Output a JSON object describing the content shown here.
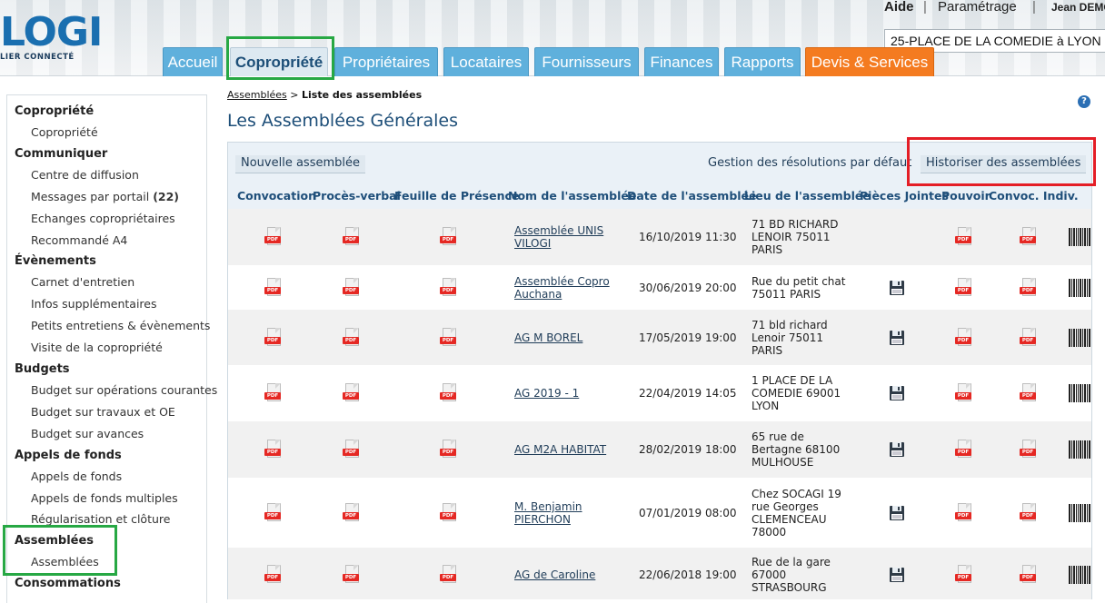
{
  "header": {
    "logo_text": "LOGI",
    "logo_sub": "LIER CONNECTÉ",
    "aide": "Aide",
    "sep": "|",
    "parametrage": "Paramétrage",
    "user": "Jean DEMO",
    "property": "25-PLACE DE LA COMEDIE à LYON"
  },
  "tabs": [
    {
      "label": "Accueil"
    },
    {
      "label": "Copropriété"
    },
    {
      "label": "Propriétaires"
    },
    {
      "label": "Locataires"
    },
    {
      "label": "Fournisseurs"
    },
    {
      "label": "Finances"
    },
    {
      "label": "Rapports"
    },
    {
      "label": "Devis & Services"
    }
  ],
  "sidebar": [
    {
      "label": "Copropriété"
    },
    {
      "label": "Copropriété"
    },
    {
      "label": "Communiquer"
    },
    {
      "label": "Centre de diffusion"
    },
    {
      "label": "Messages par portail",
      "count": "(22)"
    },
    {
      "label": "Echanges copropriétaires"
    },
    {
      "label": "Recommandé A4"
    },
    {
      "label": "Évènements"
    },
    {
      "label": "Carnet d'entretien"
    },
    {
      "label": "Infos supplémentaires"
    },
    {
      "label": "Petits entretiens & évènements"
    },
    {
      "label": "Visite de la copropriété"
    },
    {
      "label": "Budgets"
    },
    {
      "label": "Budget sur opérations courantes"
    },
    {
      "label": "Budget sur travaux et OE"
    },
    {
      "label": "Budget sur avances"
    },
    {
      "label": "Appels de fonds"
    },
    {
      "label": "Appels de fonds"
    },
    {
      "label": "Appels de fonds multiples"
    },
    {
      "label": "Régularisation et clôture"
    },
    {
      "label": "Assemblées"
    },
    {
      "label": "Assemblées"
    },
    {
      "label": "Consommations"
    }
  ],
  "breadcrumb": {
    "link": "Assemblées",
    "sep": " > ",
    "current": "Liste des assemblées"
  },
  "help": "?",
  "page_title": "Les Assemblées Générales",
  "buttons": {
    "new": "Nouvelle assemblée",
    "resolutions": "Gestion des résolutions par défaut",
    "history": "Historiser des assemblées"
  },
  "columns": [
    "Convocation",
    "Procès-verbal",
    "Feuille de Présence",
    "Nom de l'assemblée",
    "Date de l'assemblée",
    "Lieu de l'assemblée",
    "Pièces Jointes",
    "Pouvoir",
    "Convoc. Indiv."
  ],
  "pdf_label": "PDF",
  "rows": [
    {
      "name": [
        "Assemblée UNIS",
        "VILOGI"
      ],
      "date": "16/10/2019 11:30",
      "lieu": [
        "71 BD RICHARD",
        "LENOIR 75011",
        "PARIS"
      ],
      "attach": false
    },
    {
      "name": [
        "Assemblée Copro",
        "Auchana"
      ],
      "date": "30/06/2019 20:00",
      "lieu": [
        "Rue du petit chat",
        "75011 PARIS"
      ],
      "attach": true
    },
    {
      "name": [
        "AG M BOREL"
      ],
      "date": "17/05/2019 19:00",
      "lieu": [
        "71 bld richard",
        "Lenoir 75011",
        "PARIS"
      ],
      "attach": true
    },
    {
      "name": [
        "AG 2019 - 1"
      ],
      "date": "22/04/2019 14:05",
      "lieu": [
        "1 PLACE DE LA",
        "COMEDIE 69001",
        "LYON"
      ],
      "attach": true
    },
    {
      "name": [
        "AG M2A HABITAT"
      ],
      "date": "28/02/2019 18:00",
      "lieu": [
        "65 rue de",
        "Bertagne 68100",
        "MULHOUSE"
      ],
      "attach": true
    },
    {
      "name": [
        "M. Benjamin",
        "PIERCHON"
      ],
      "date": "07/01/2019 08:00",
      "lieu": [
        "Chez SOCAGI 19",
        "rue Georges",
        "CLEMENCEAU",
        "78000"
      ],
      "attach": true
    },
    {
      "name": [
        "AG de Caroline"
      ],
      "date": "22/06/2018 19:00",
      "lieu": [
        "Rue de la gare",
        "67000",
        "STRASBOURG"
      ],
      "attach": true
    }
  ]
}
